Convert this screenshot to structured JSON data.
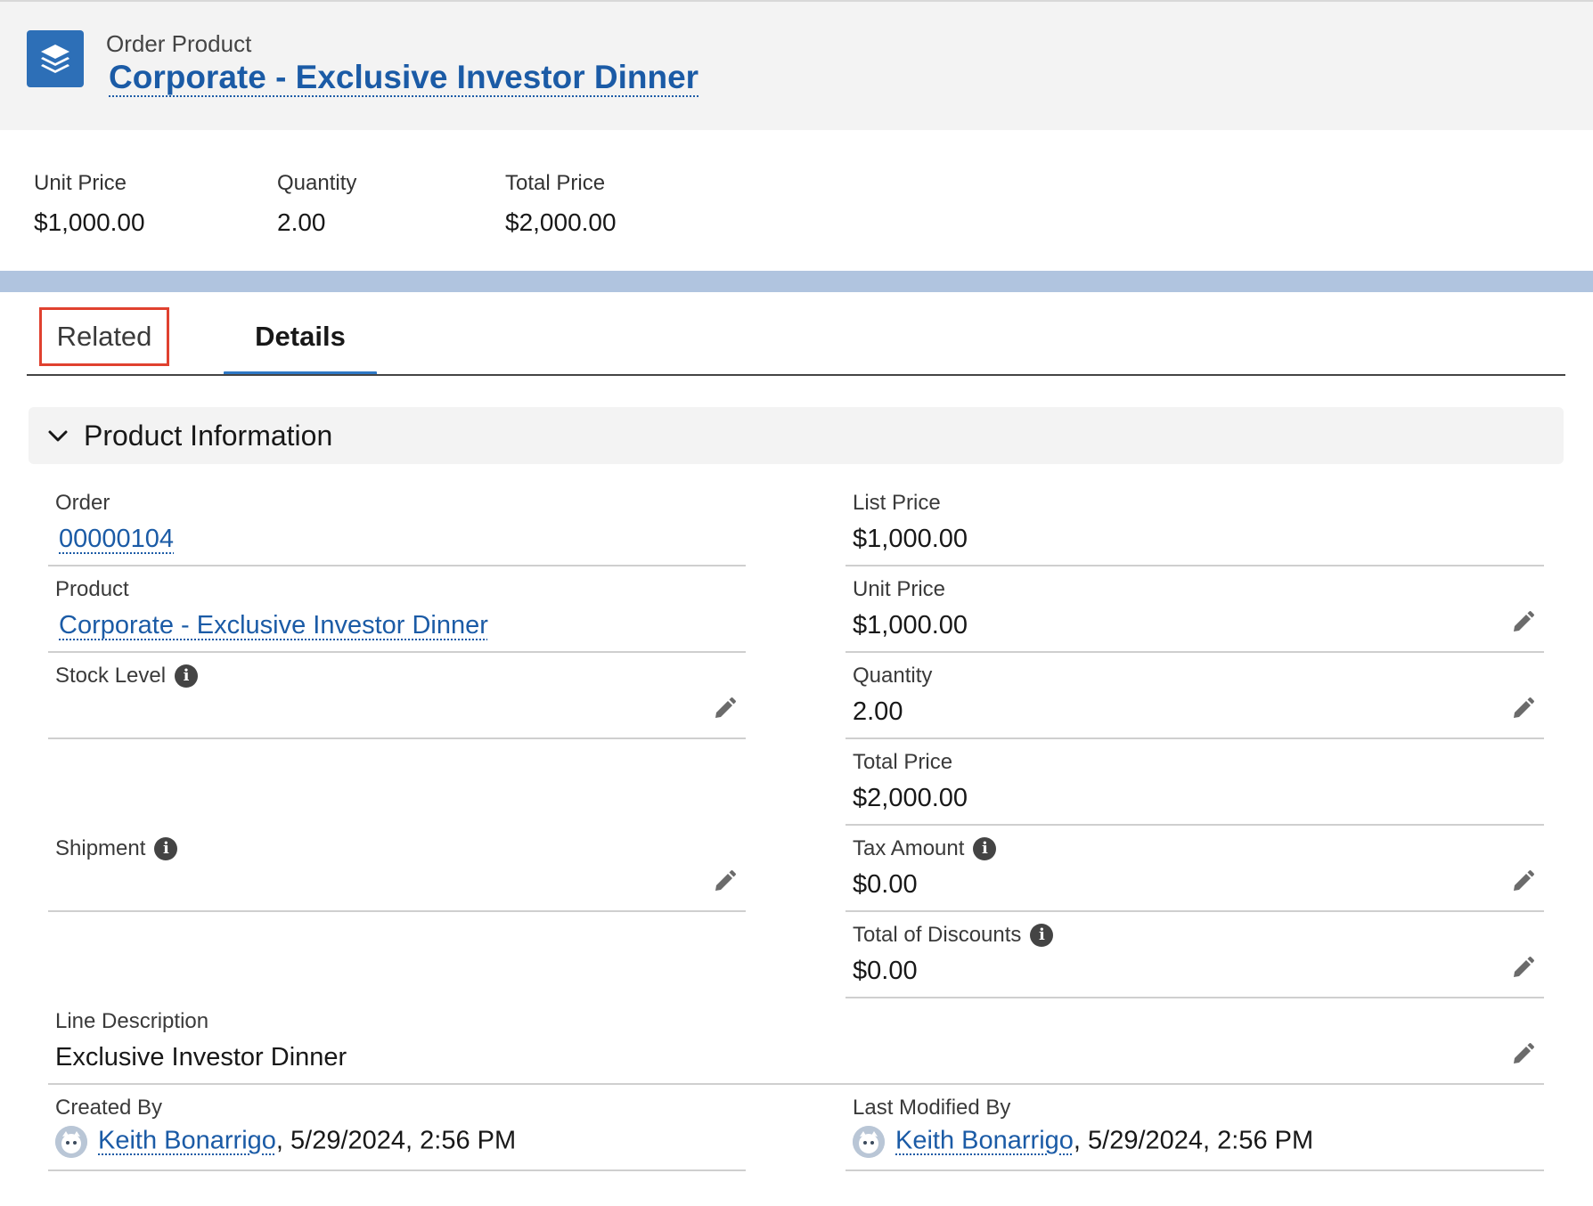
{
  "header": {
    "object_type": "Order Product",
    "title": "Corporate - Exclusive Investor Dinner"
  },
  "highlights": [
    {
      "label": "Unit Price",
      "value": "$1,000.00"
    },
    {
      "label": "Quantity",
      "value": "2.00"
    },
    {
      "label": "Total Price",
      "value": "$2,000.00"
    }
  ],
  "tabs": {
    "related": "Related",
    "details": "Details"
  },
  "section": {
    "title": "Product Information"
  },
  "fields": {
    "order": {
      "label": "Order",
      "value": "00000104"
    },
    "product": {
      "label": "Product",
      "value": "Corporate - Exclusive Investor Dinner"
    },
    "stock_level": {
      "label": "Stock Level",
      "value": ""
    },
    "shipment": {
      "label": "Shipment",
      "value": ""
    },
    "list_price": {
      "label": "List Price",
      "value": "$1,000.00"
    },
    "unit_price": {
      "label": "Unit Price",
      "value": "$1,000.00"
    },
    "quantity": {
      "label": "Quantity",
      "value": "2.00"
    },
    "total_price": {
      "label": "Total Price",
      "value": "$2,000.00"
    },
    "tax_amount": {
      "label": "Tax Amount",
      "value": "$0.00"
    },
    "total_discounts": {
      "label": "Total of Discounts",
      "value": "$0.00"
    },
    "line_description": {
      "label": "Line Description",
      "value": "Exclusive Investor Dinner"
    },
    "created_by": {
      "label": "Created By",
      "user": "Keith Bonarrigo",
      "date": ", 5/29/2024, 2:56 PM"
    },
    "last_modified_by": {
      "label": "Last Modified By",
      "user": "Keith Bonarrigo",
      "date": ", 5/29/2024, 2:56 PM"
    }
  },
  "colors": {
    "brand_blue": "#1b5ba6",
    "icon_blue": "#2d6fb7",
    "tab_active": "#2e78c6",
    "highlight_box": "#e0412f"
  }
}
